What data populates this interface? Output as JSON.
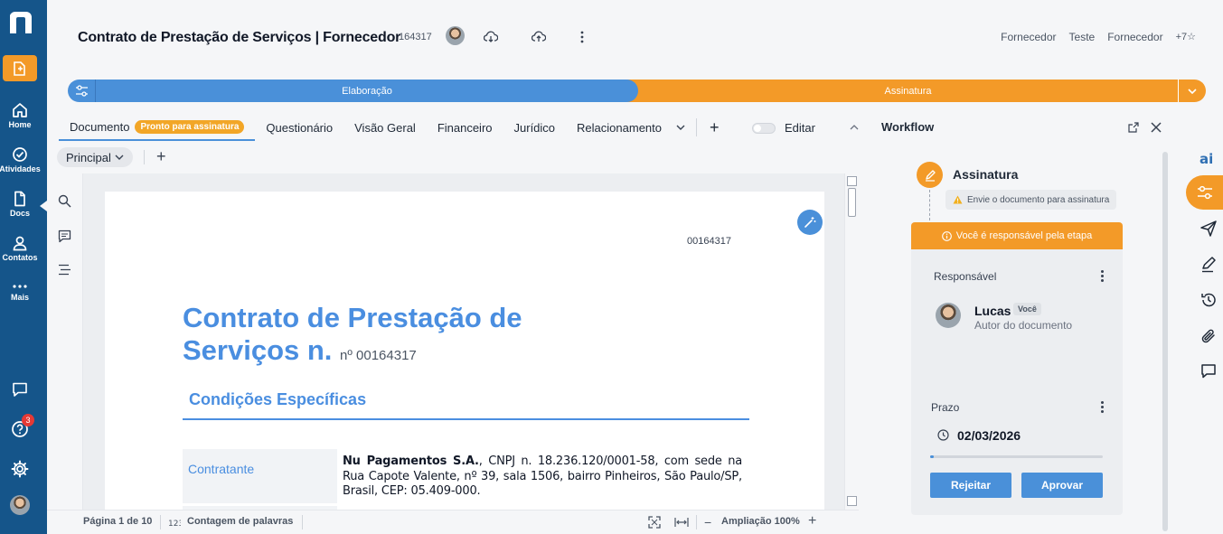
{
  "nav": {
    "items": [
      {
        "label": "Home",
        "icon": "home-icon"
      },
      {
        "label": "Atividades",
        "icon": "check-circle-icon"
      },
      {
        "label": "Docs",
        "icon": "document-icon"
      },
      {
        "label": "Contatos",
        "icon": "person-icon"
      },
      {
        "label": "Mais",
        "icon": "more-dots-icon"
      }
    ],
    "help_badge": "3"
  },
  "header": {
    "title": "Contrato de Prestação de Serviços | Fornecedor",
    "doc_number": "164317",
    "tags": [
      "Fornecedor",
      "Teste",
      "Fornecedor"
    ],
    "more_tags": "+7"
  },
  "stages": {
    "current": "Elaboração",
    "next": "Assinatura"
  },
  "tabs": {
    "items": [
      "Documento",
      "Questionário",
      "Visão Geral",
      "Financeiro",
      "Jurídico",
      "Relacionamento"
    ],
    "status_pill": "Pronto para assinatura",
    "edit_label": "Editar"
  },
  "subtabs": {
    "principal": "Principal"
  },
  "document": {
    "code": "00164317",
    "title_line1": "Contrato de Prestação de",
    "title_line2": "Serviços n.",
    "title_number": "nº 00164317",
    "section": "Condições Específicas",
    "row_label": "Contratante",
    "row_company": "Nu Pagamentos S.A.",
    "row_text": ", CNPJ n. 18.236.120/0001-58, com sede na Rua Capote Valente, nº 39, sala 1506, bairro Pinheiros, São Paulo/SP, Brasil, CEP: 05.409-000."
  },
  "footer": {
    "page_info": "Página 1 de 10",
    "word_count": "Contagem de palavras",
    "zoom": "Ampliação 100%"
  },
  "workflow": {
    "title": "Workflow",
    "step_name": "Assinatura",
    "warning": "Envie o documento para assinatura",
    "banner": "Você é responsável pela etapa",
    "responsible_label": "Responsável",
    "user_name": "Lucas",
    "user_badge": "Você",
    "user_role": "Autor do documento",
    "deadline_label": "Prazo",
    "deadline": "02/03/2026",
    "progress": 0.02,
    "reject_label": "Rejeitar",
    "approve_label": "Aprovar"
  },
  "colors": {
    "rail": "#15558a",
    "accent_blue": "#4a90d9",
    "accent_orange": "#f39a28"
  }
}
